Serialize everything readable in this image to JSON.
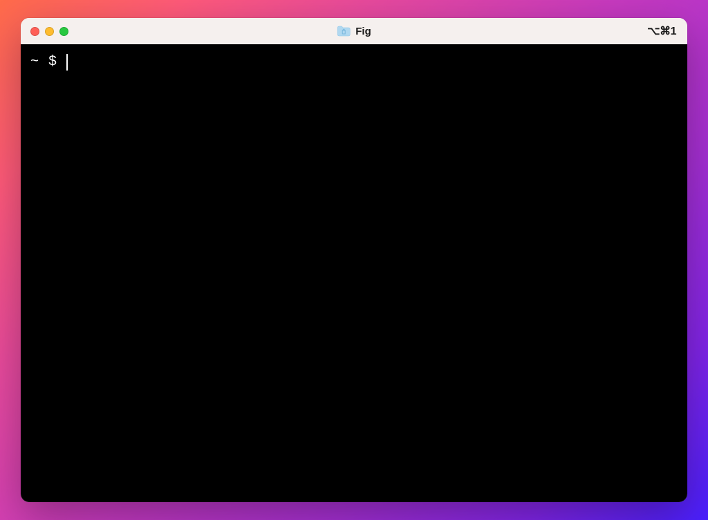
{
  "window": {
    "title": "Fig",
    "shortcut": "⌥⌘1"
  },
  "terminal": {
    "prompt_cwd": "~",
    "prompt_symbol": "$",
    "input": ""
  },
  "colors": {
    "close": "#ff5f57",
    "minimize": "#febc2e",
    "maximize": "#28c840",
    "terminal_bg": "#000000",
    "terminal_fg": "#ffffff"
  }
}
